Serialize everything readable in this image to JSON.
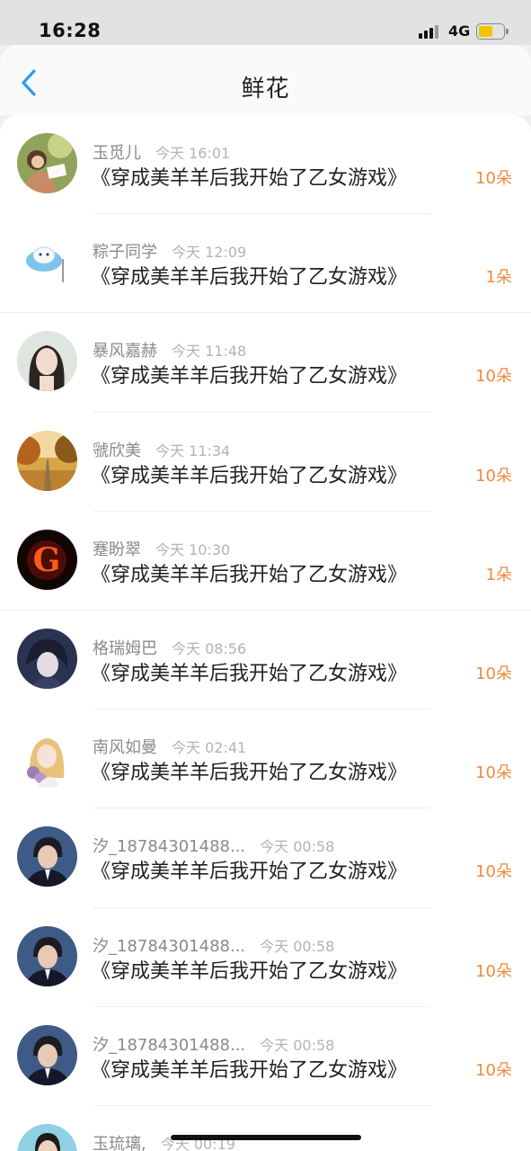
{
  "status_bar": {
    "time": "16:28",
    "network": "4G",
    "battery_level": 0.58,
    "battery_color": "#f5c400"
  },
  "nav": {
    "title": "鲜花",
    "back_icon": "chevron-left-icon",
    "back_color": "#2a9df4"
  },
  "accent_color": "#ef8a3c",
  "items": [
    {
      "username": "玉觅儿",
      "time": "今天 16:01",
      "book": "《穿成美羊羊后我开始了乙女游戏》",
      "count": "10朵",
      "avatar": "woman-reading-avatar"
    },
    {
      "username": "粽子同学",
      "time": "今天 12:09",
      "book": "《穿成美羊羊后我开始了乙女游戏》",
      "count": "1朵",
      "avatar": "cartoon-cat-avatar"
    },
    {
      "username": "暴风嘉赫",
      "time": "今天 11:48",
      "book": "《穿成美羊羊后我开始了乙女游戏》",
      "count": "10朵",
      "avatar": "girl-portrait-avatar"
    },
    {
      "username": "虢欣美",
      "time": "今天 11:34",
      "book": "《穿成美羊羊后我开始了乙女游戏》",
      "count": "10朵",
      "avatar": "autumn-road-avatar"
    },
    {
      "username": "蹇盼翠",
      "time": "今天 10:30",
      "book": "《穿成美羊羊后我开始了乙女游戏》",
      "count": "1朵",
      "avatar": "fire-letter-g-avatar"
    },
    {
      "username": "格瑞姆巴",
      "time": "今天 08:56",
      "book": "《穿成美羊羊后我开始了乙女游戏》",
      "count": "10朵",
      "avatar": "anime-boy-avatar"
    },
    {
      "username": "南风如曼",
      "time": "今天 02:41",
      "book": "《穿成美羊羊后我开始了乙女游戏》",
      "count": "10朵",
      "avatar": "anime-girl-flowers-avatar"
    },
    {
      "username": "汐_18784301488...",
      "time": "今天 00:58",
      "book": "《穿成美羊羊后我开始了乙女游戏》",
      "count": "10朵",
      "avatar": "suit-man-avatar"
    },
    {
      "username": "汐_18784301488...",
      "time": "今天 00:58",
      "book": "《穿成美羊羊后我开始了乙女游戏》",
      "count": "10朵",
      "avatar": "suit-man-avatar"
    },
    {
      "username": "汐_18784301488...",
      "time": "今天 00:58",
      "book": "《穿成美羊羊后我开始了乙女游戏》",
      "count": "10朵",
      "avatar": "suit-man-avatar"
    },
    {
      "username": "玉琉璃,",
      "time": "今天 00:19",
      "book": "",
      "count": "",
      "avatar": "man-portrait-avatar"
    }
  ]
}
